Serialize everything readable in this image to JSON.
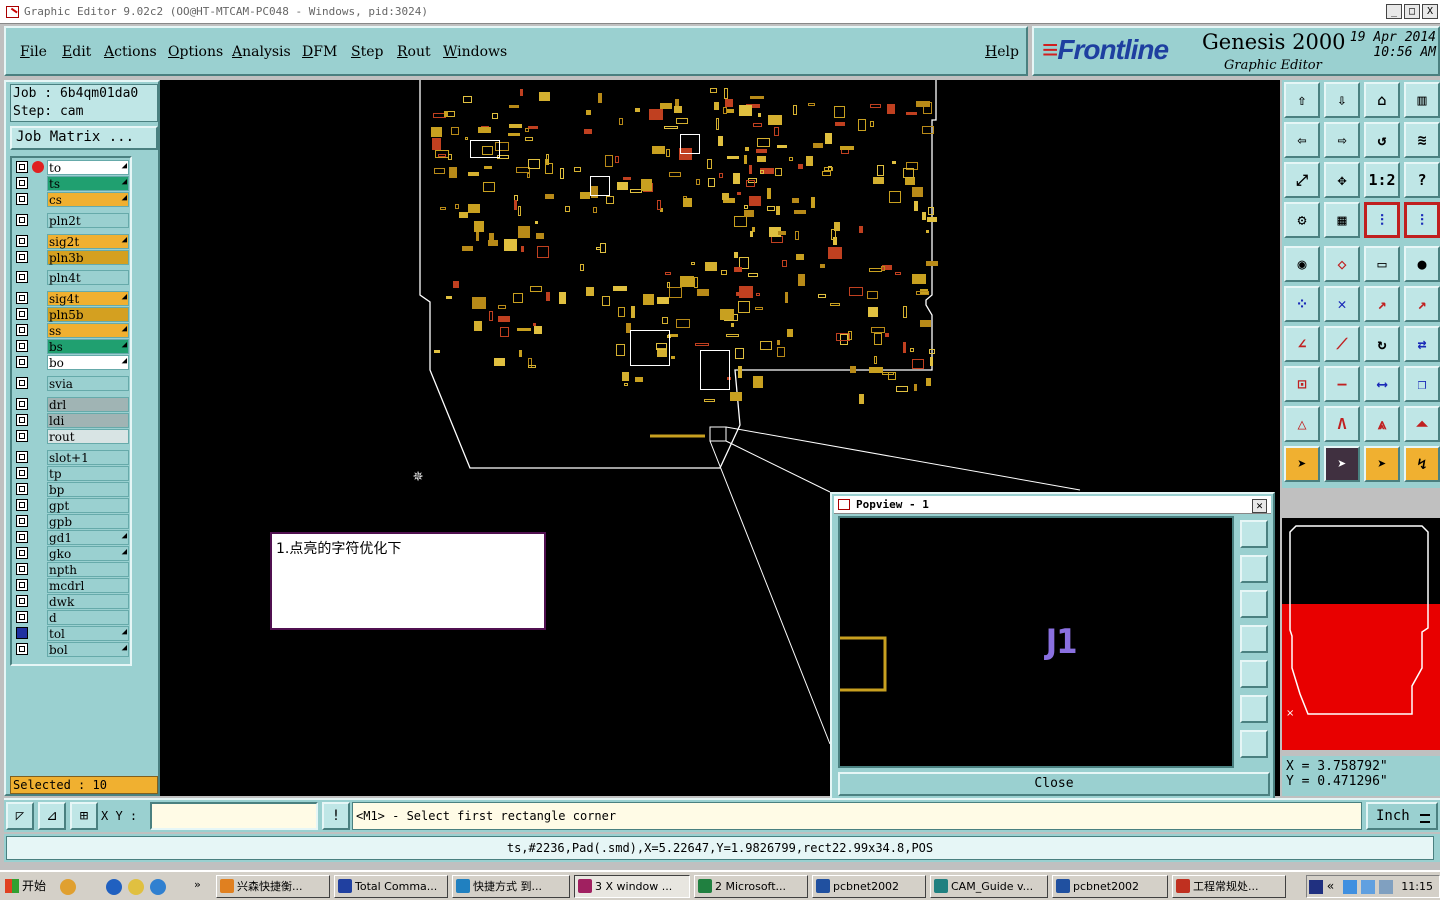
{
  "window": {
    "title": "Graphic Editor 9.02c2  (OO@HT-MTCAM-PC048 - Windows, pid:3024)",
    "buttons": [
      "_",
      "□",
      "X"
    ]
  },
  "menu": [
    "File",
    "Edit",
    "Actions",
    "Options",
    "Analysis",
    "DFM",
    "Step",
    "Rout",
    "Windows"
  ],
  "help_label": "Help",
  "brand": {
    "logo": "Frontline",
    "product": "Genesis 2000",
    "subtitle": "Graphic Editor",
    "date": "19 Apr 2014",
    "time": "10:56 AM"
  },
  "job": {
    "job_line": "Job : 6b4qm01da0",
    "step_line": "Step: cam",
    "matrix_button": "Job Matrix ..."
  },
  "layers": [
    {
      "name": "to",
      "color": "#ffffff",
      "dot": "#e02020",
      "edit": true
    },
    {
      "name": "ts",
      "color": "#20a070",
      "edit": true
    },
    {
      "name": "cs",
      "color": "#f0b030",
      "edit": true
    },
    {
      "name": "pln2t",
      "color": "#9ad0d0",
      "edit": false
    },
    {
      "name": "sig2t",
      "color": "#f0b030",
      "edit": true
    },
    {
      "name": "pln3b",
      "color": "#d4a020",
      "edit": false
    },
    {
      "name": "pln4t",
      "color": "#9ad0d0",
      "edit": false
    },
    {
      "name": "sig4t",
      "color": "#f0b030",
      "edit": true
    },
    {
      "name": "pln5b",
      "color": "#d4a020",
      "edit": false
    },
    {
      "name": "ss",
      "color": "#f0b030",
      "edit": true
    },
    {
      "name": "bs",
      "color": "#20a070",
      "edit": true
    },
    {
      "name": "bo",
      "color": "#ffffff",
      "edit": true
    },
    {
      "name": "svia",
      "color": "#9ad0d0",
      "edit": false
    },
    {
      "name": "drl",
      "color": "#a0b4b4",
      "edit": false
    },
    {
      "name": "ldi",
      "color": "#a0b4b4",
      "edit": false
    },
    {
      "name": "rout",
      "color": "#d8e4e4",
      "edit": false
    },
    {
      "name": "slot+1",
      "color": "#9ad0d0",
      "edit": false
    },
    {
      "name": "tp",
      "color": "#9ad0d0",
      "edit": false
    },
    {
      "name": "bp",
      "color": "#9ad0d0",
      "edit": false
    },
    {
      "name": "gpt",
      "color": "#9ad0d0",
      "edit": false
    },
    {
      "name": "gpb",
      "color": "#9ad0d0",
      "edit": false
    },
    {
      "name": "gd1",
      "color": "#9ad0d0",
      "edit": true
    },
    {
      "name": "gko",
      "color": "#9ad0d0",
      "edit": true
    },
    {
      "name": "npth",
      "color": "#9ad0d0",
      "edit": false
    },
    {
      "name": "mcdrl",
      "color": "#9ad0d0",
      "edit": false
    },
    {
      "name": "dwk",
      "color": "#9ad0d0",
      "edit": false
    },
    {
      "name": "d",
      "color": "#9ad0d0",
      "edit": false
    },
    {
      "name": "tol",
      "color": "#9ad0d0",
      "edit": true,
      "selected": true
    },
    {
      "name": "bol",
      "color": "#9ad0d0",
      "edit": true
    }
  ],
  "selected_count": "Selected : 10",
  "note_text": "1.点亮的字符优化下",
  "popview": {
    "title": "Popview - 1",
    "label": "J1",
    "close_label": "Close"
  },
  "coords": {
    "x": "X = 3.758792\"",
    "y": "Y = 0.471296\""
  },
  "command": {
    "xy_label": "X Y :",
    "xy_value": "",
    "prompt": "<M1> - Select first rectangle corner",
    "unit": "Inch"
  },
  "status_line": "ts,#2236,Pad(.smd),X=5.22647,Y=1.9826799,rect22.99x34.8,POS",
  "taskbar": {
    "start": "开始",
    "tasks": [
      "兴森快捷衡...",
      "Total Comma...",
      "快捷方式 到...",
      "3 X window ...",
      "2 Microsoft...",
      "pcbnet2002",
      "CAM_Guide v...",
      "pcbnet2002",
      "工程常规处..."
    ],
    "clock": "11:15"
  }
}
